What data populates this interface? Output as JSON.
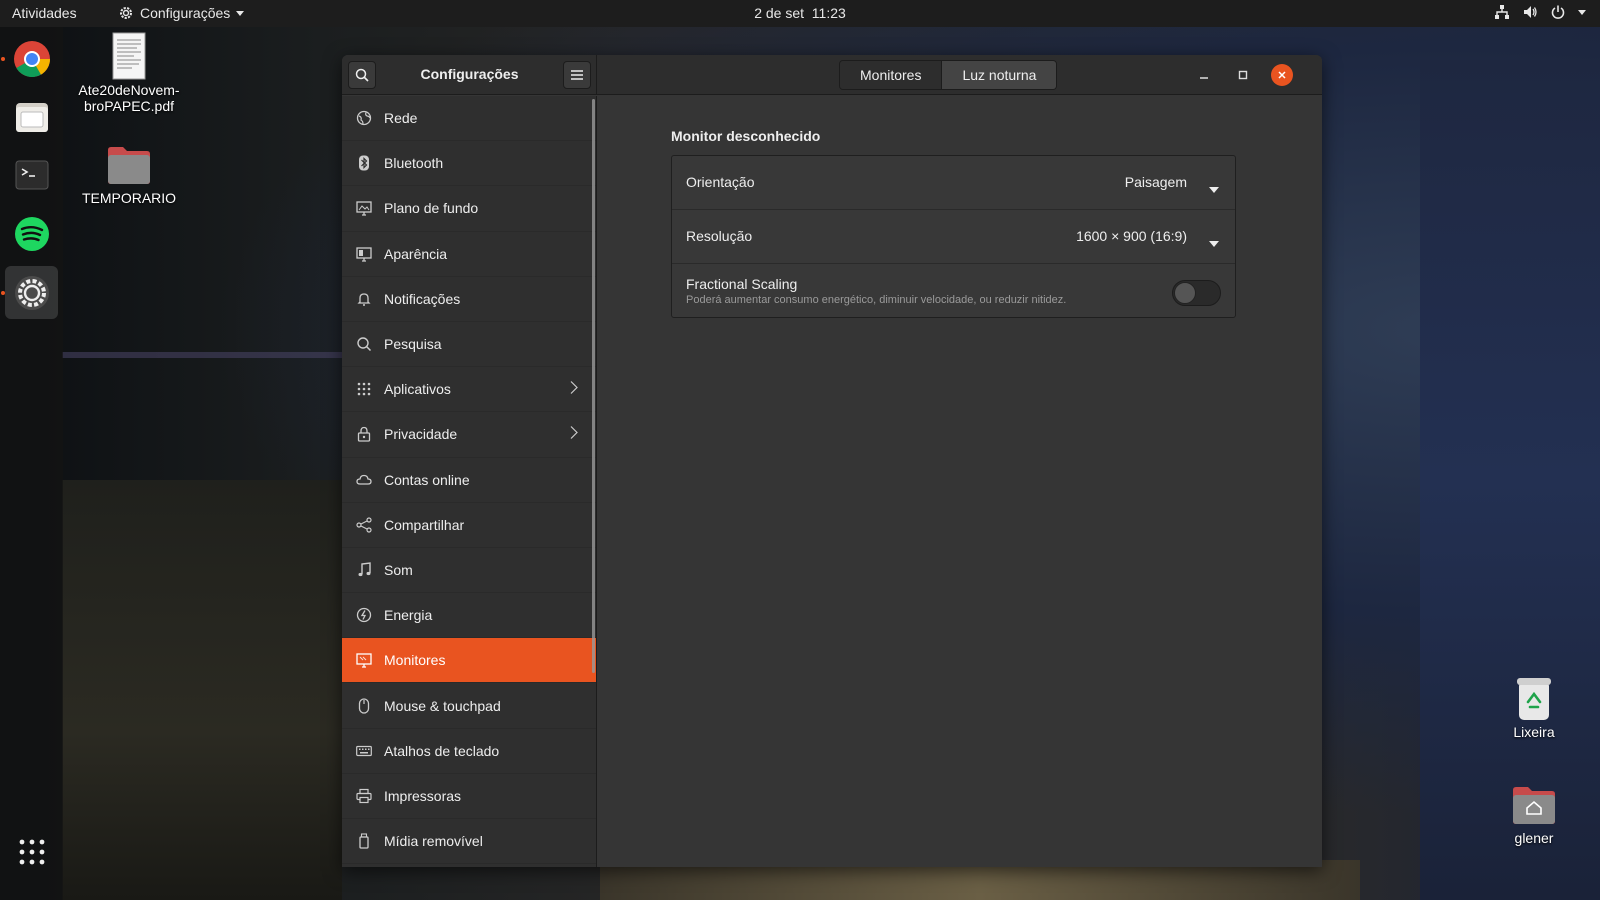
{
  "topbar": {
    "activities": "Atividades",
    "app_menu": "Configurações",
    "clock_date": "2 de set",
    "clock_time": "11:23",
    "tray_icons": [
      "network-icon",
      "volume-icon",
      "power-icon"
    ]
  },
  "dock": {
    "items": [
      {
        "name": "chrome-icon",
        "running": true
      },
      {
        "name": "files-icon",
        "running": false
      },
      {
        "name": "terminal-icon",
        "running": false
      },
      {
        "name": "spotify-icon",
        "running": false
      },
      {
        "name": "settings-icon",
        "running": true,
        "active": true
      }
    ],
    "show_apps": "apps-grid-icon"
  },
  "desktop": {
    "icons": [
      {
        "label_line1": "Ate20deNovem-",
        "label_line2": "broPAPEC.pdf",
        "icon": "pdf-icon"
      },
      {
        "label": "TEMPORARIO",
        "icon": "folder-icon"
      },
      {
        "label": "Lixeira",
        "icon": "trash-icon"
      },
      {
        "label": "glener",
        "icon": "home-folder-icon"
      }
    ]
  },
  "window": {
    "title": "Configurações",
    "tabs": [
      {
        "label": "Monitores",
        "selected": false
      },
      {
        "label": "Luz noturna",
        "selected": true
      }
    ],
    "sidebar": {
      "items": [
        {
          "label": "Rede",
          "icon": "network-globe-icon"
        },
        {
          "label": "Bluetooth",
          "icon": "bluetooth-icon"
        },
        {
          "label": "Plano de fundo",
          "icon": "background-icon"
        },
        {
          "label": "Aparência",
          "icon": "appearance-icon"
        },
        {
          "label": "Notificações",
          "icon": "bell-icon"
        },
        {
          "label": "Pesquisa",
          "icon": "search-icon"
        },
        {
          "label": "Aplicativos",
          "icon": "apps-icon",
          "arrow": true
        },
        {
          "label": "Privacidade",
          "icon": "lock-icon",
          "arrow": true
        },
        {
          "label": "Contas online",
          "icon": "cloud-icon"
        },
        {
          "label": "Compartilhar",
          "icon": "share-icon"
        },
        {
          "label": "Som",
          "icon": "music-note-icon"
        },
        {
          "label": "Energia",
          "icon": "power-icon"
        },
        {
          "label": "Monitores",
          "icon": "monitor-icon",
          "selected": true
        },
        {
          "label": "Mouse & touchpad",
          "icon": "mouse-icon"
        },
        {
          "label": "Atalhos de teclado",
          "icon": "keyboard-icon"
        },
        {
          "label": "Impressoras",
          "icon": "printer-icon"
        },
        {
          "label": "Mídia removível",
          "icon": "usb-icon"
        }
      ]
    },
    "content": {
      "section_title": "Monitor desconhecido",
      "orientation": {
        "label": "Orientação",
        "value": "Paisagem"
      },
      "resolution": {
        "label": "Resolução",
        "value": "1600 × 900 (16:9)"
      },
      "fractional_scaling": {
        "label": "Fractional Scaling",
        "description": "Poderá aumentar consumo energético, diminuir velocidade, ou reduzir nitidez.",
        "enabled": false
      }
    }
  },
  "colors": {
    "accent": "#e95420",
    "window_bg": "#353535",
    "sidebar_bg": "#2f2f2f",
    "headerbar_bg": "#2d2d2d"
  }
}
